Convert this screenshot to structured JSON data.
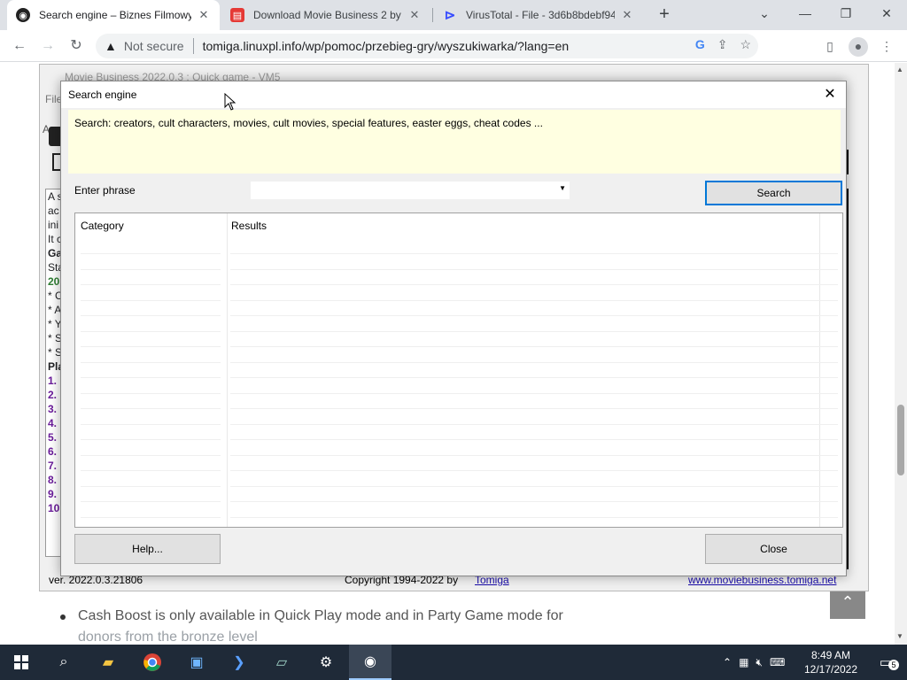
{
  "browser": {
    "tabs": [
      {
        "title": "Search engine – Biznes Filmowy",
        "icon": "movie-business-favicon",
        "active": true
      },
      {
        "title": "Download Movie Business 2 by t",
        "icon": "softpedia-favicon",
        "active": false
      },
      {
        "title": "VirusTotal - File - 3d6b8bdebf94",
        "icon": "virustotal-favicon",
        "active": false
      }
    ],
    "new_tab_label": "+",
    "security_label": "Not secure",
    "url": "tomiga.linuxpl.info/wp/pomoc/przebieg-gry/wyszukiwarka/?lang=en"
  },
  "app_window": {
    "title": "Movie Business 2022.0.3 : Quick game - VM5",
    "menu_first": "File",
    "panel_lines": [
      "A s",
      " ac",
      " ini",
      "It c",
      "",
      "Ga",
      "Sta",
      "20",
      "* C",
      "* A",
      "* Y",
      "* S",
      "* S",
      "",
      "Pla",
      "1.",
      "2.",
      "3.",
      "4.",
      "5.",
      "6.",
      "7.",
      "8.",
      "9.",
      "10"
    ],
    "version": "ver. 2022.0.3.21806",
    "copyright": "Copyright 1994-2022 by",
    "author_link": "Tomiga",
    "website_link": "www.moviebusiness.tomiga.net"
  },
  "dialog": {
    "title": "Search engine",
    "hint": "Search: creators, cult characters, movies, cult movies, special features, easter eggs, cheat codes ...",
    "phrase_label": "Enter phrase",
    "phrase_value": "",
    "search_button": "Search",
    "columns": [
      "Category",
      "Results"
    ],
    "help_button": "Help...",
    "close_button": "Close"
  },
  "webpage": {
    "bullet_text_line1": "Cash Boost is only available in Quick Play mode and in Party Game mode for",
    "bullet_text_line2": "donors from the bronze level"
  },
  "taskbar": {
    "time": "8:49 AM",
    "date": "12/17/2022",
    "notification_count": "5"
  },
  "colors": {
    "hint_background": "#ffffe1",
    "default_button_border": "#0078d7",
    "taskbar": "#1f2a38",
    "tabstrip": "#dee1e6"
  }
}
